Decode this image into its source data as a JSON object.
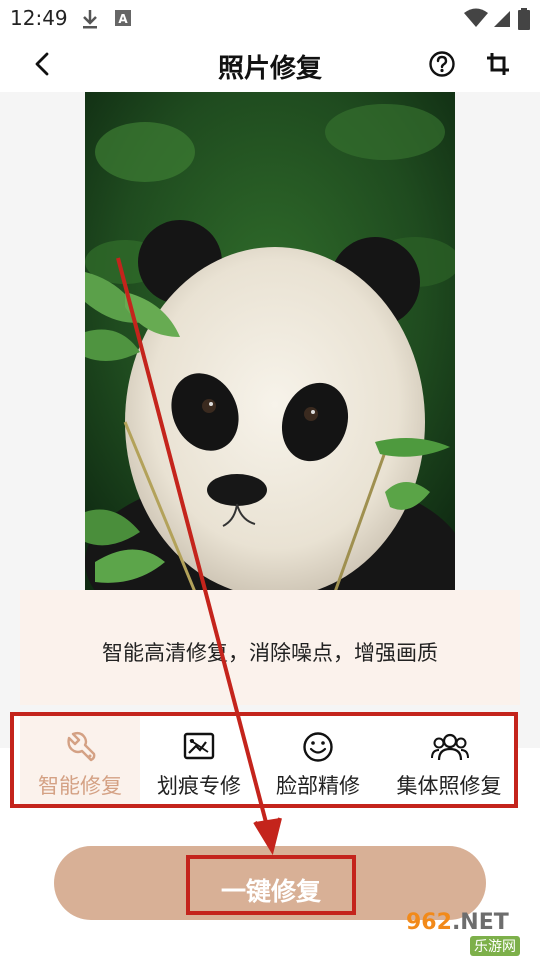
{
  "status_bar": {
    "time": "12:49",
    "icons": [
      "download-icon",
      "app-notification-icon",
      "wifi-icon",
      "signal-icon",
      "battery-icon"
    ]
  },
  "app_bar": {
    "title": "照片修复",
    "back_icon": "chevron-left-icon",
    "help_icon": "question-circle-icon",
    "crop_icon": "crop-icon"
  },
  "photo": {
    "subject": "panda-photo"
  },
  "description": {
    "text": "智能高清修复，消除噪点，增强画质"
  },
  "modes": [
    {
      "label": "智能修复",
      "icon": "wrench-icon",
      "active": true
    },
    {
      "label": "划痕专修",
      "icon": "scratch-image-icon",
      "active": false
    },
    {
      "label": "脸部精修",
      "icon": "smiley-face-icon",
      "active": false
    },
    {
      "label": "集体照修复",
      "icon": "group-people-icon",
      "active": false
    }
  ],
  "action": {
    "repair_label": "一键修复"
  },
  "watermark": {
    "top": "962",
    "top_suffix": ".NET",
    "bottom": "乐游网"
  },
  "colors": {
    "accent": "#d8b096",
    "active_label": "#d4a184",
    "highlight_red": "#c4241c",
    "panel_bg": "#fbf2ec"
  }
}
